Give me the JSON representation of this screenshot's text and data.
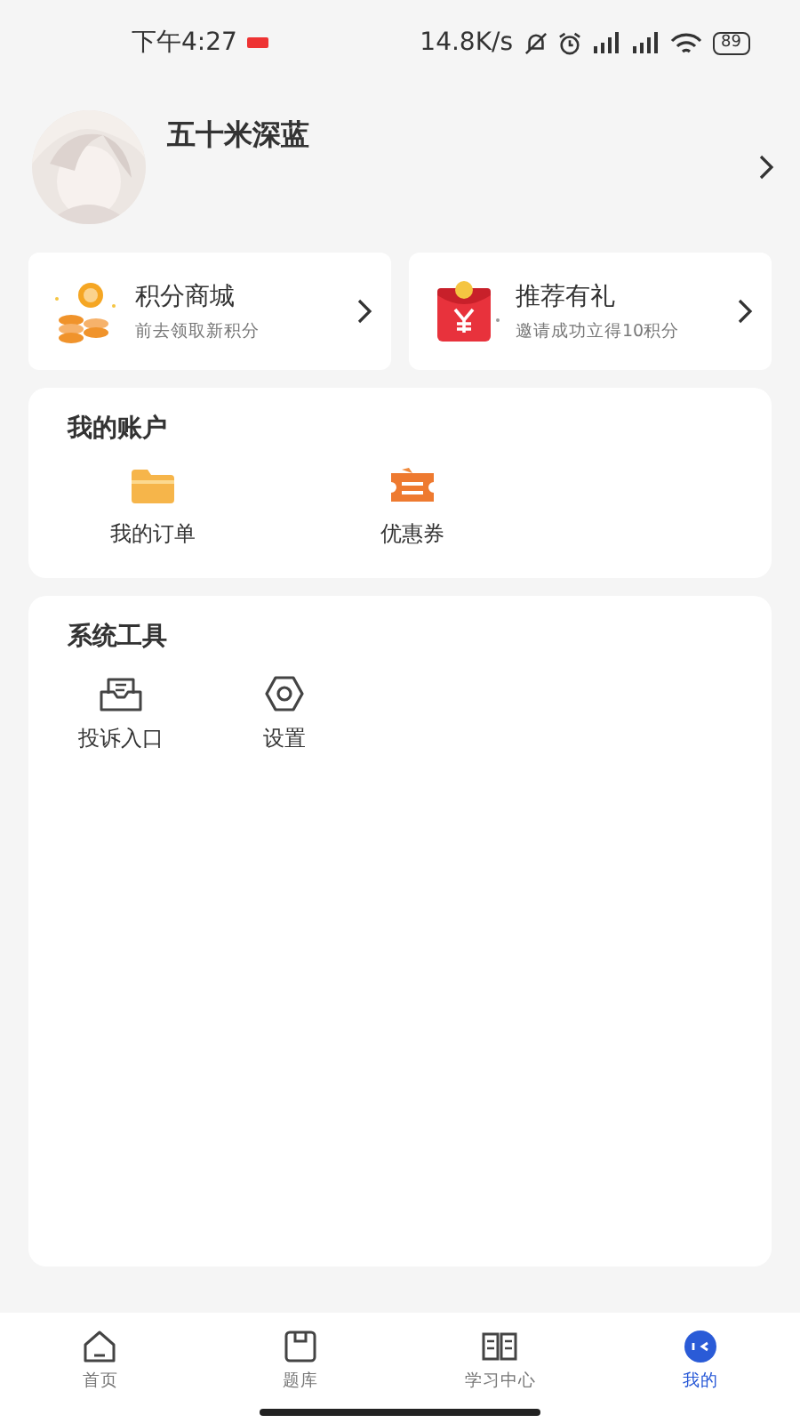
{
  "status_bar": {
    "time": "下午4:27",
    "speed": "14.8K/s",
    "battery": "89"
  },
  "profile": {
    "name": "五十米深蓝"
  },
  "promos": [
    {
      "kind": "coins",
      "title": "积分商城",
      "subtitle": "前去领取新积分"
    },
    {
      "kind": "redpacket",
      "title": "推荐有礼",
      "subtitle": "邀请成功立得10积分"
    }
  ],
  "sections": [
    {
      "title": "我的账户",
      "items": [
        {
          "kind": "folder",
          "label": "我的订单"
        },
        {
          "kind": "ticket",
          "label": "优惠券"
        }
      ]
    },
    {
      "title": "系统工具",
      "items": [
        {
          "kind": "inbox",
          "label": "投诉入口"
        },
        {
          "kind": "gear",
          "label": "设置"
        }
      ]
    }
  ],
  "tabs": [
    {
      "kind": "home",
      "label": "首页",
      "selected": false
    },
    {
      "kind": "box",
      "label": "题库",
      "selected": false
    },
    {
      "kind": "book",
      "label": "学习中心",
      "selected": false
    },
    {
      "kind": "me",
      "label": "我的",
      "selected": true
    }
  ]
}
